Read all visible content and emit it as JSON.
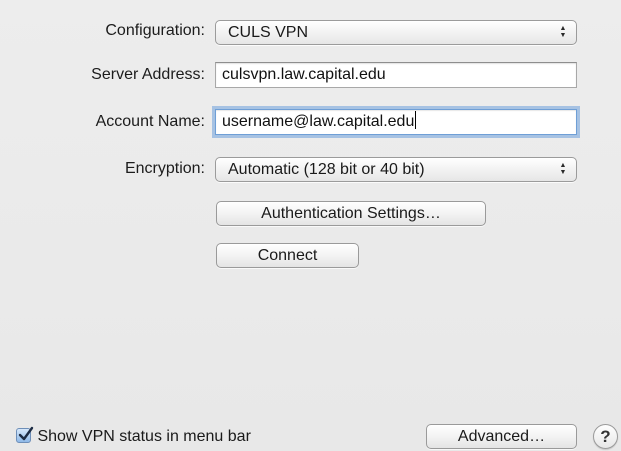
{
  "form": {
    "configuration": {
      "label": "Configuration:",
      "selected": "CULS VPN"
    },
    "server_address": {
      "label": "Server Address:",
      "value": "culsvpn.law.capital.edu"
    },
    "account_name": {
      "label": "Account Name:",
      "value": "username@law.capital.edu"
    },
    "encryption": {
      "label": "Encryption:",
      "selected": "Automatic (128 bit or 40 bit)"
    },
    "auth_settings_label": "Authentication Settings…",
    "connect_label": "Connect"
  },
  "footer": {
    "show_status_label": "Show VPN status in menu bar",
    "show_status_checked": true,
    "advanced_label": "Advanced…",
    "help_label": "?"
  },
  "icons": {
    "popup_arrows": "up-down-arrows-icon",
    "checkmark": "checkmark-icon",
    "help": "question-mark-icon"
  },
  "colors": {
    "focus_ring": "#6f9fd6",
    "panel_background": "#ececec"
  }
}
